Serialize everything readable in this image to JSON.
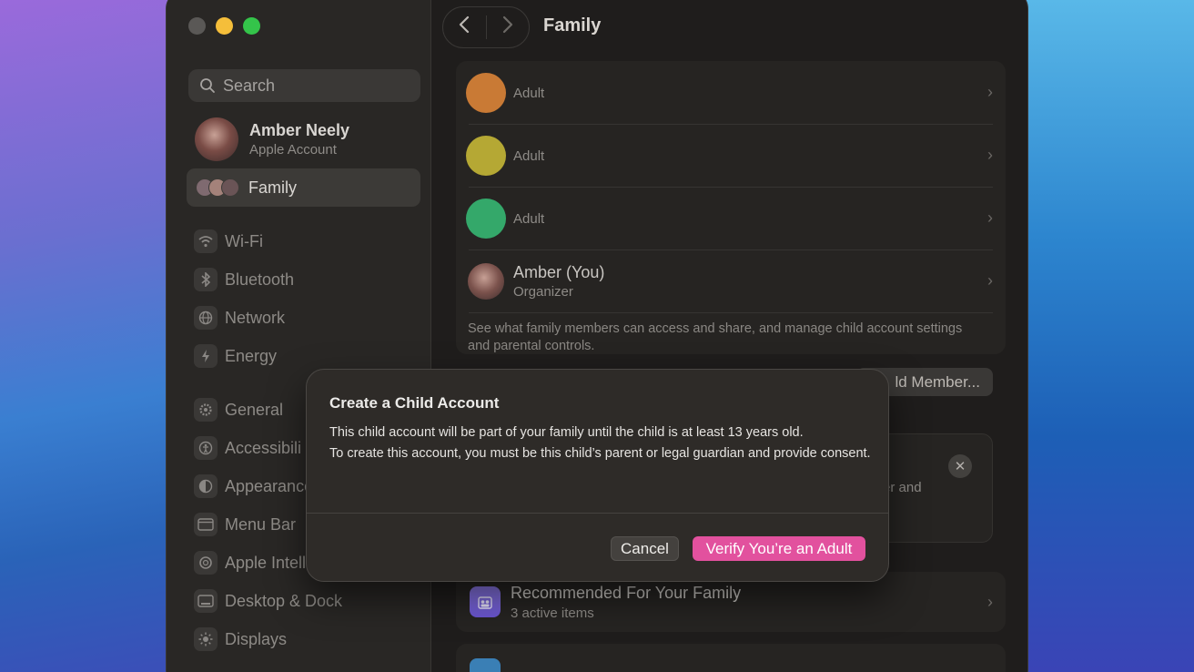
{
  "window": {
    "title": "Family"
  },
  "sidebar": {
    "search_placeholder": "Search",
    "account": {
      "name": "Amber Neely",
      "subtitle": "Apple Account"
    },
    "family_label": "Family",
    "items": [
      {
        "label": "Wi-Fi",
        "icon": "wifi-icon"
      },
      {
        "label": "Bluetooth",
        "icon": "bluetooth-icon"
      },
      {
        "label": "Network",
        "icon": "globe-icon"
      },
      {
        "label": "Energy",
        "icon": "bolt-icon"
      },
      {
        "label": "General",
        "icon": "gear-icon"
      },
      {
        "label": "Accessibili",
        "icon": "accessibility-icon"
      },
      {
        "label": "Appearance",
        "icon": "appearance-icon"
      },
      {
        "label": "Menu Bar",
        "icon": "menubar-icon"
      },
      {
        "label": "Apple Intelli",
        "icon": "sparkle-icon"
      },
      {
        "label": "Desktop & Dock",
        "icon": "dock-icon"
      },
      {
        "label": "Displays",
        "icon": "sun-icon"
      }
    ]
  },
  "members": [
    {
      "name": "",
      "role": "Adult",
      "color": "#c97a35"
    },
    {
      "name": "",
      "role": "Adult",
      "color": "#b5a834"
    },
    {
      "name": "",
      "role": "Adult",
      "color": "#34a86a"
    },
    {
      "name": "Amber (You)",
      "role": "Organizer",
      "color": "#8a6a68"
    }
  ],
  "members_note": "See what family members can access and share, and manage child account settings and parental controls.",
  "add_member_label": "ld Member...",
  "promo": {
    "text": "er and"
  },
  "recommended": {
    "title": "Recommended For Your Family",
    "subtitle": "3 active items"
  },
  "dialog": {
    "title": "Create a Child Account",
    "paragraph1": "This child account will be part of your family until the child is at least 13 years old.",
    "paragraph2": "To create this account, you must be this child’s parent or legal guardian and provide consent.",
    "cancel_label": "Cancel",
    "verify_label": "Verify You’re an Adult"
  },
  "colors": {
    "accent": "#e2519e"
  }
}
